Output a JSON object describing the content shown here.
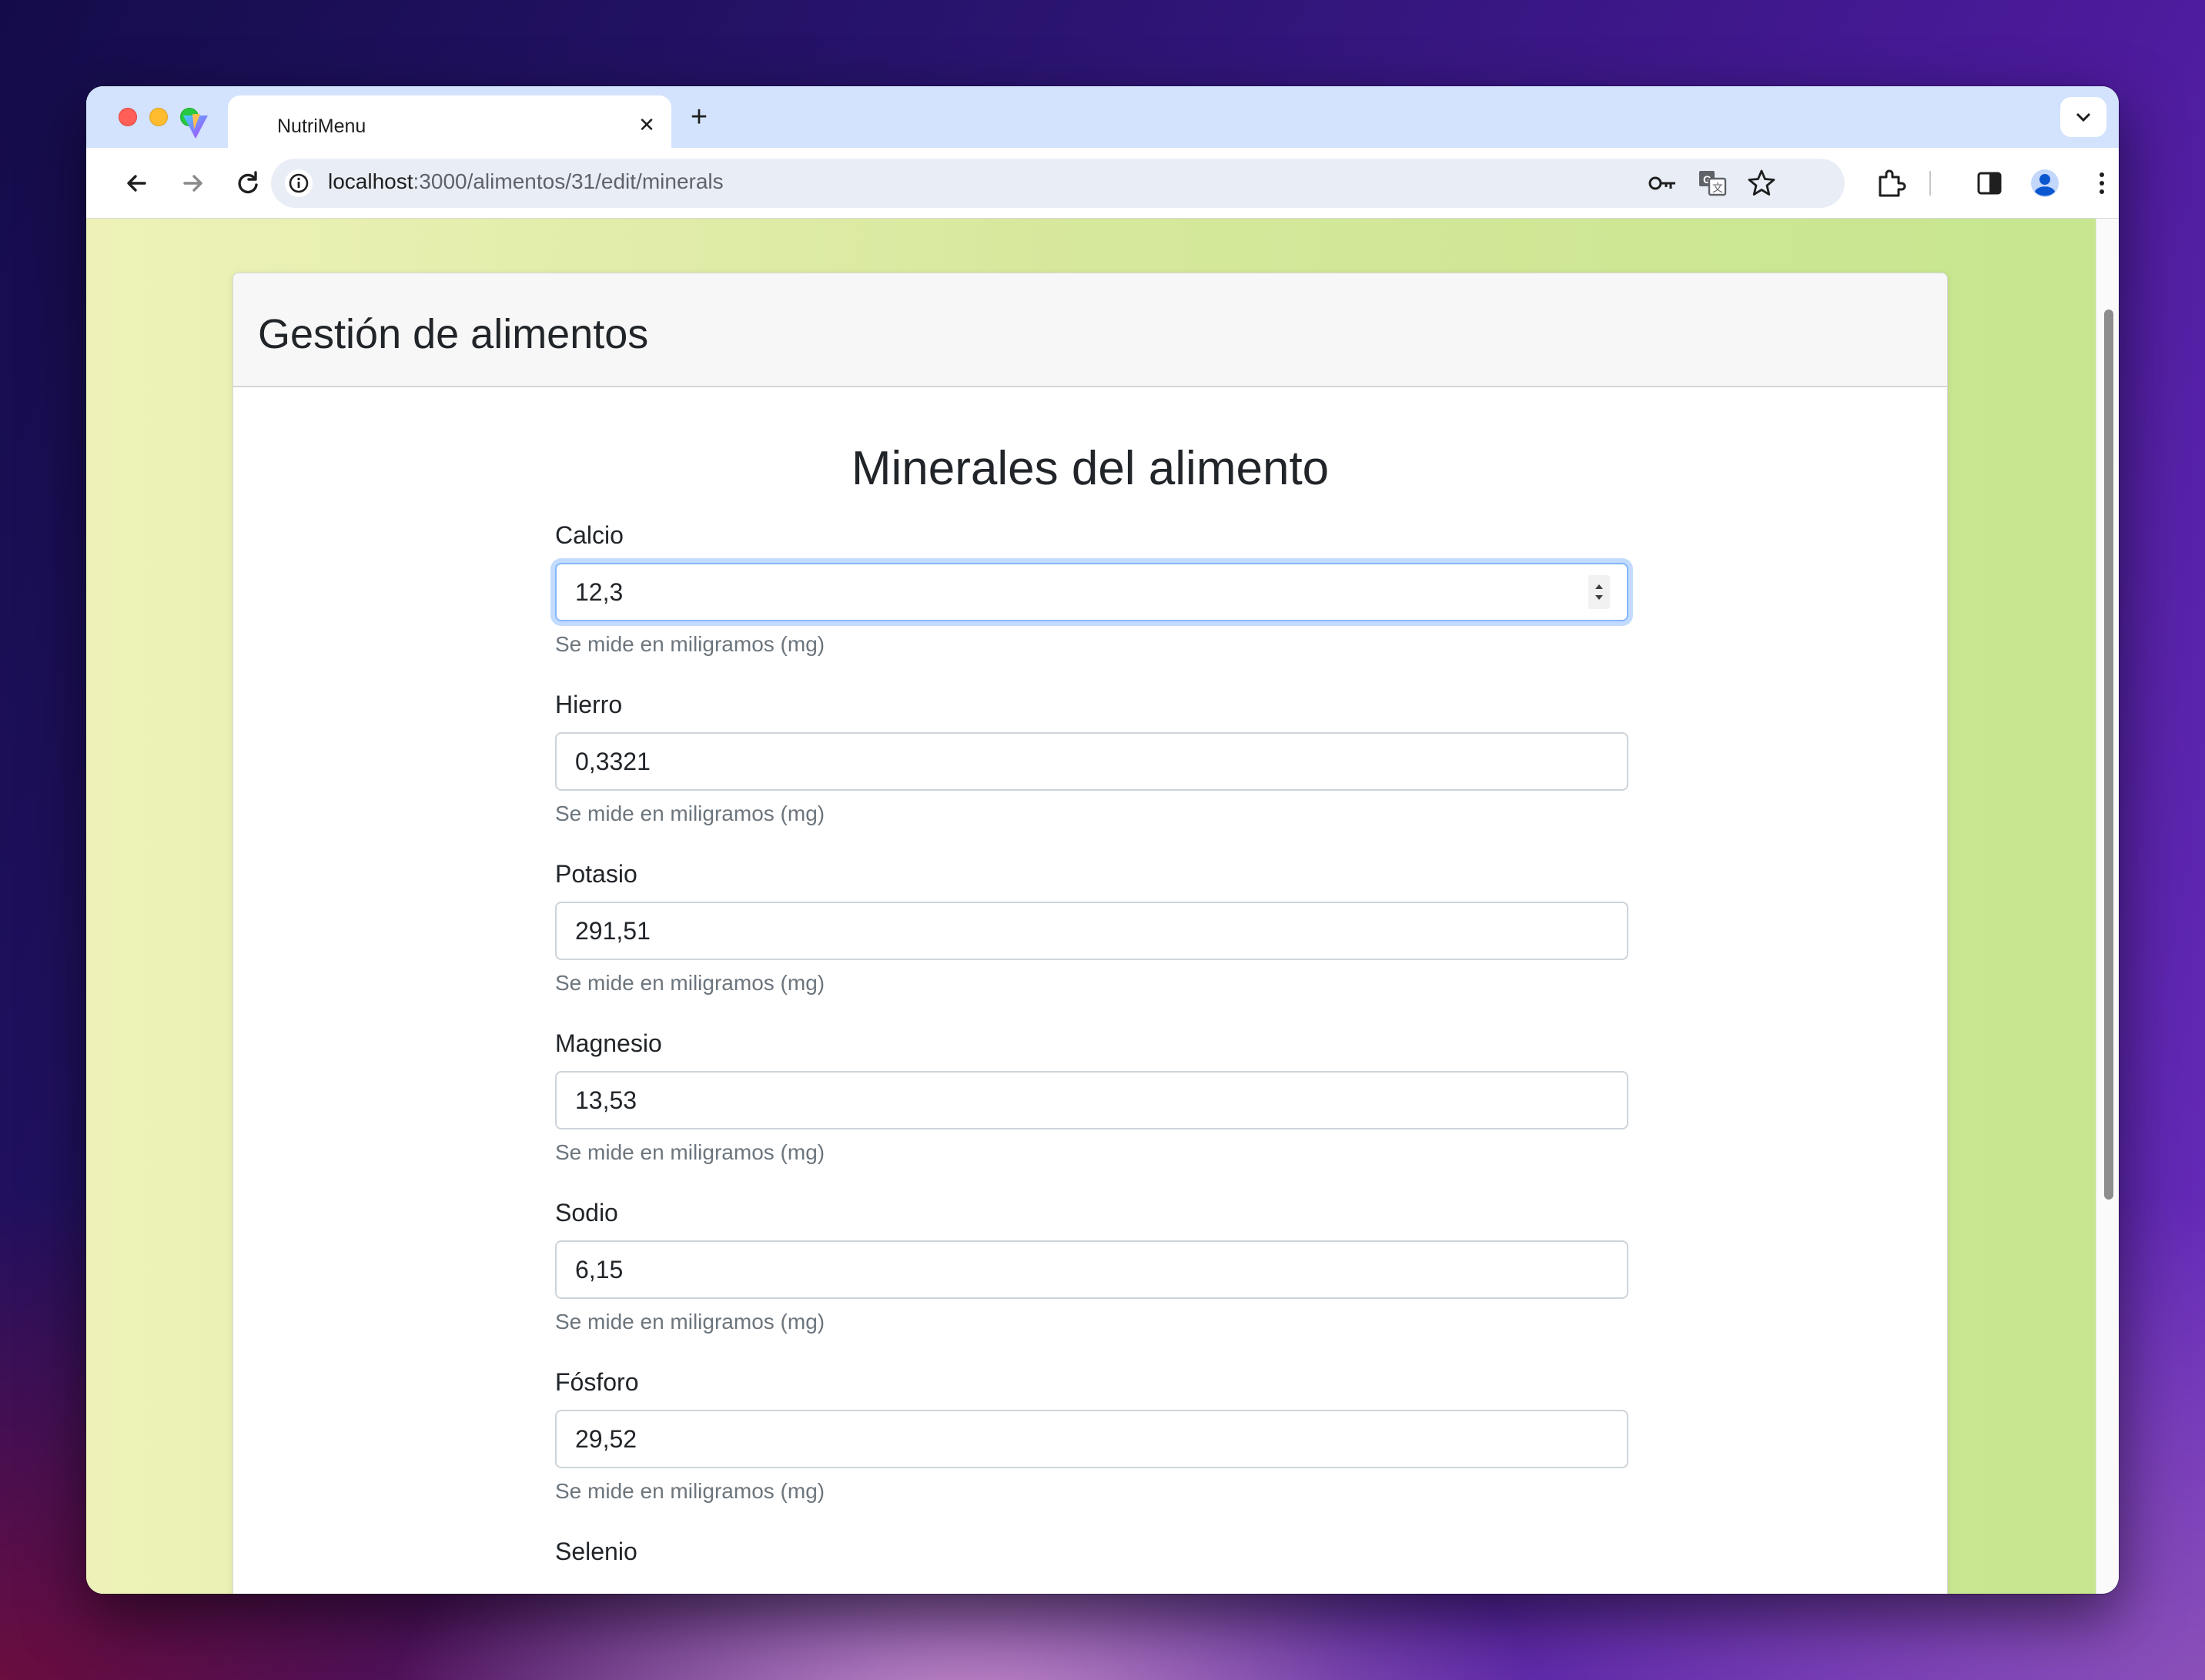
{
  "browser": {
    "tab_title": "NutriMenu",
    "tab_close_label": "✕",
    "new_tab_label": "+",
    "url_host": "localhost",
    "url_path": ":3000/alimentos/31/edit/minerals"
  },
  "page": {
    "header_title": "Gestión de alimentos",
    "form_title": "Minerales del alimento"
  },
  "fields": [
    {
      "label": "Calcio",
      "value": "12,3",
      "help": "Se mide en miligramos (mg)"
    },
    {
      "label": "Hierro",
      "value": "0,3321",
      "help": "Se mide en miligramos (mg)"
    },
    {
      "label": "Potasio",
      "value": "291,51",
      "help": "Se mide en miligramos (mg)"
    },
    {
      "label": "Magnesio",
      "value": "13,53",
      "help": "Se mide en miligramos (mg)"
    },
    {
      "label": "Sodio",
      "value": "6,15",
      "help": "Se mide en miligramos (mg)"
    },
    {
      "label": "Fósforo",
      "value": "29,52",
      "help": "Se mide en miligramos (mg)"
    },
    {
      "label": "Selenio"
    }
  ],
  "colors": {
    "focus_ring": "#86b7fe",
    "tabstrip": "#d3e3fd",
    "page_bg_start": "#eef2b8",
    "page_bg_end": "#c7e68f"
  },
  "icons": [
    "back-arrow-icon",
    "forward-arrow-icon",
    "reload-icon",
    "site-info-icon",
    "password-key-icon",
    "translate-icon",
    "bookmark-star-icon",
    "extensions-icon",
    "side-panel-icon",
    "profile-icon",
    "more-menu-icon",
    "tab-search-icon"
  ]
}
